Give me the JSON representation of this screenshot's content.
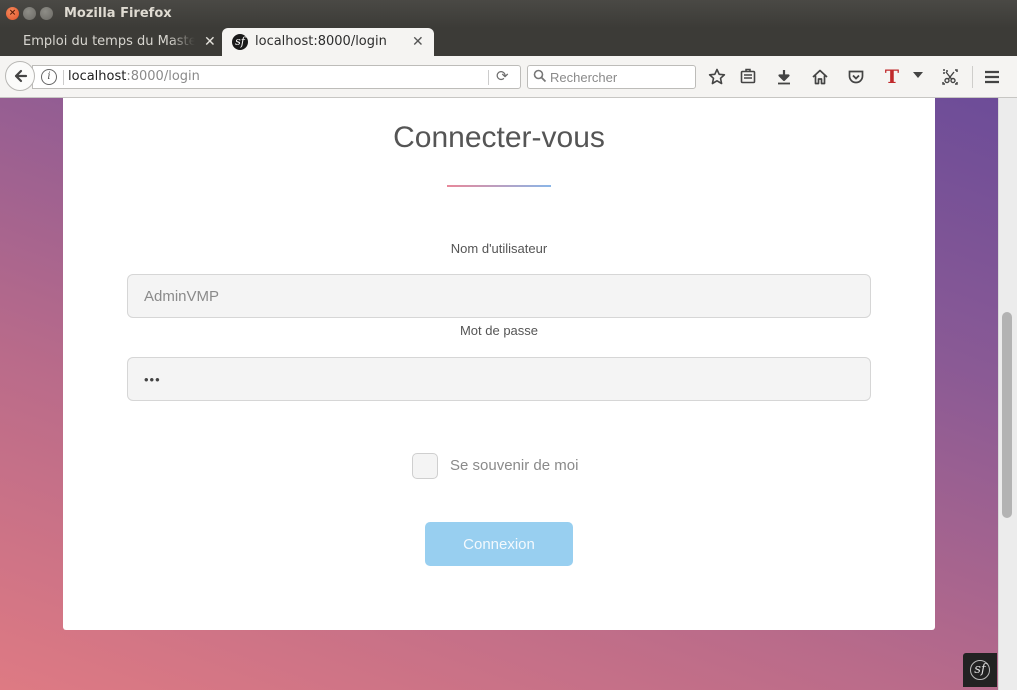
{
  "window": {
    "title": "Mozilla Firefox"
  },
  "tabs": [
    {
      "label": "Emploi du temps du Master G",
      "active": false
    },
    {
      "label": "localhost:8000/login",
      "active": true
    }
  ],
  "navbar": {
    "url_host": "localhost",
    "url_rest": ":8000/login",
    "search_placeholder": "Rechercher"
  },
  "toolbar_icons": [
    "back-icon",
    "info-icon",
    "reload-icon",
    "search-icon",
    "bookmark-star-icon",
    "reading-list-icon",
    "download-icon",
    "home-icon",
    "pocket-icon",
    "text-tool-icon",
    "dropdown-arrow-icon",
    "screenshot-icon",
    "menu-icon"
  ],
  "login": {
    "title": "Connecter-vous",
    "username_label": "Nom d'utilisateur",
    "username_value": "AdminVMP",
    "password_label": "Mot de passe",
    "password_value": "•••",
    "remember_label": "Se souvenir de moi",
    "submit_label": "Connexion"
  },
  "colors": {
    "submit_bg": "#98cff0",
    "gradient_start": "#6c4c98",
    "gradient_end": "#de7a83",
    "underline_left": "#e8889a",
    "underline_right": "#8ab6e8"
  }
}
